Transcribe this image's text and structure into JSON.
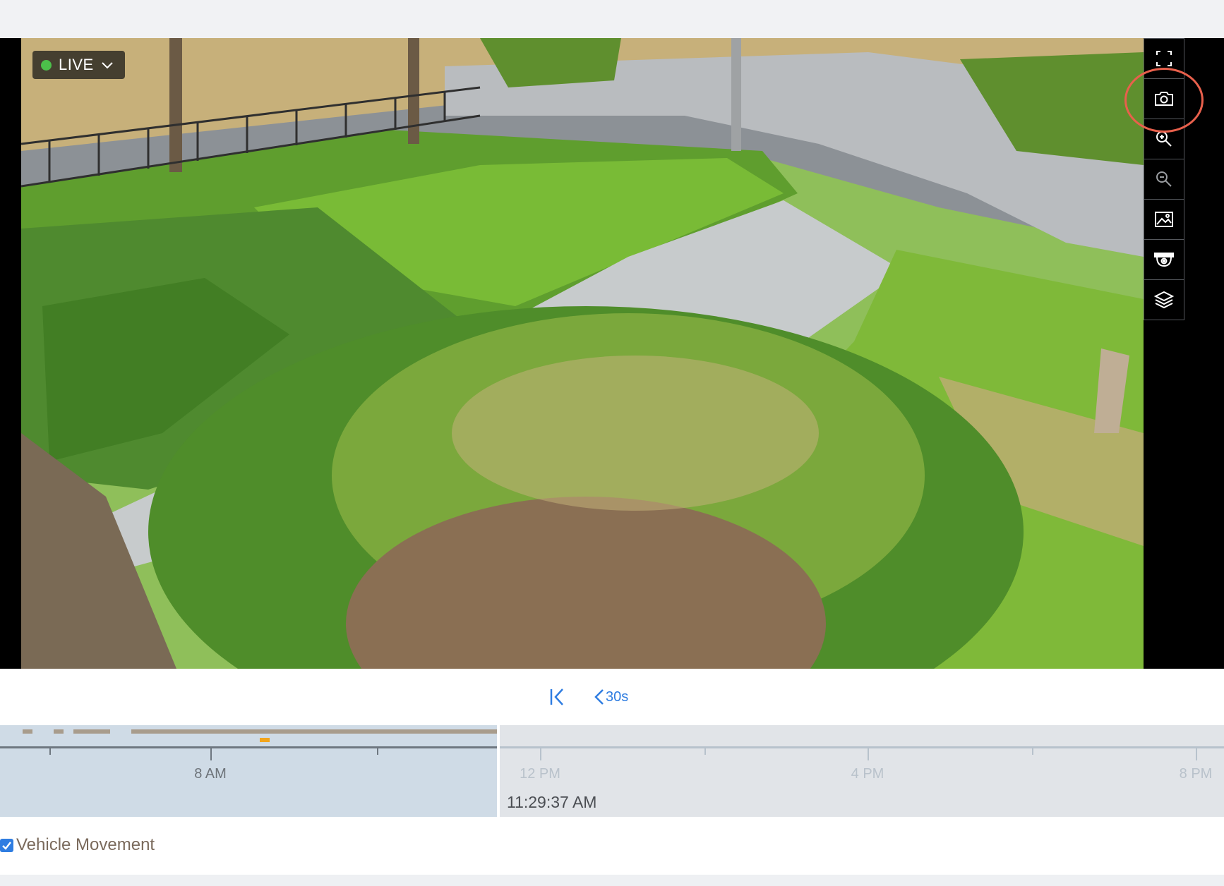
{
  "colors": {
    "live_dot": "#4cc04a",
    "accent_blue": "#2f7de1",
    "highlight_ring": "#e8604c",
    "event_recording": "#a89c8c",
    "event_motion": "#f2a51c",
    "timeline_past_label": "#6d7379",
    "timeline_future_label": "#b9c2cb"
  },
  "live": {
    "label": "LIVE",
    "status_icon": "status-dot",
    "menu_icon": "chevron-down-icon"
  },
  "toolbar": [
    {
      "name": "fullscreen",
      "icon": "fullscreen-icon"
    },
    {
      "name": "snapshot",
      "icon": "camera-icon",
      "highlighted": true
    },
    {
      "name": "zoom-in",
      "icon": "zoom-in-icon"
    },
    {
      "name": "zoom-out",
      "icon": "zoom-out-icon"
    },
    {
      "name": "image-settings",
      "icon": "image-icon"
    },
    {
      "name": "camera-ptz",
      "icon": "dome-camera-icon"
    },
    {
      "name": "layers",
      "icon": "layers-icon"
    }
  ],
  "playback": {
    "skip_to_start_icon": "skip-to-start-icon",
    "back_label": "30s",
    "back_icon": "chevron-left-icon"
  },
  "timeline": {
    "past_fraction": 0.406,
    "labels": [
      {
        "text": "8 AM",
        "fraction": 0.172,
        "past": true
      },
      {
        "text": "12 PM",
        "fraction": 0.441,
        "past": false
      },
      {
        "text": "4 PM",
        "fraction": 0.709,
        "past": false
      },
      {
        "text": "8 PM",
        "fraction": 0.977,
        "past": false
      }
    ],
    "current_time": "11:29:37 AM"
  },
  "filters": [
    {
      "label": "Vehicle Movement",
      "checked": true
    }
  ]
}
